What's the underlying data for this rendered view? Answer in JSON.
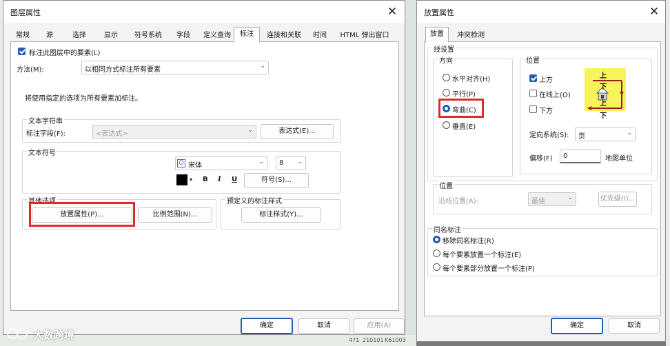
{
  "left_dialog": {
    "title": "图层属性",
    "close": "✕",
    "tabs": [
      "常规",
      "源",
      "选择",
      "显示",
      "符号系统",
      "字段",
      "定义查询",
      "标注",
      "连接和关联",
      "时间",
      "HTML 弹出窗口"
    ],
    "label_features_checkbox": "标注此图层中的要素(L)",
    "method_label": "方法(M):",
    "method_value": "以相同方式标注所有要素",
    "info_text": "将使用指定的选项为所有要素加标注。",
    "text_string_group": "文本字符串",
    "label_field_label": "标注字段(F):",
    "label_field_value": "<表达式>",
    "expression_button": "表达式(E)...",
    "text_symbol_group": "文本符号",
    "font_name": "宋体",
    "font_size": "8",
    "bold": "B",
    "italic": "I",
    "underline": "U",
    "symbol_button": "符号(S)...",
    "other_options_group": "其他选项",
    "placement_button": "放置属性(P)...",
    "scale_range_button": "比例范围(N)...",
    "predefined_group": "预定义的标注样式",
    "label_styles_button": "标注样式(Y)...",
    "ok": "确定",
    "cancel": "取消",
    "apply": "应用(A)"
  },
  "right_dialog": {
    "title": "放置属性",
    "close": "✕",
    "tabs": [
      "放置",
      "冲突检测"
    ],
    "line_settings": "线设置",
    "orientation_group": "方向",
    "orientation_options": [
      "水平对齐(H)",
      "平行(P)",
      "弯曲(C)",
      "垂直(E)"
    ],
    "orientation_selected": "弯曲(C)",
    "position_group": "位置",
    "position_options": [
      {
        "label": "上方",
        "checked": true
      },
      {
        "label": "在线上(O)",
        "checked": false
      },
      {
        "label": "下方",
        "checked": false
      }
    ],
    "preview_above": "上",
    "preview_below": "下",
    "orientation_system_label": "定向系统(S):",
    "orientation_system_value": "页",
    "offset_label": "偏移(F)",
    "offset_value": "0",
    "map_units": "地图单位",
    "location_group": "位置",
    "along_line_label": "沿线位置(A):",
    "along_line_value": "最佳",
    "priority_button": "优先级(I)...",
    "duplicate_group": "同名标注",
    "duplicate_options": [
      "移除同名标注(R)",
      "每个要素放置一个标注(E)",
      "每个要素部分放置一个标注(P)"
    ],
    "duplicate_selected": "移除同名标注(R)",
    "ok": "确定",
    "cancel": "取消"
  },
  "watermark": "大数跨境",
  "background_map_numbers": [
    "471",
    "210101",
    "K61003"
  ],
  "colors": {
    "accent": "#1f5fb3",
    "highlight": "#e02b2b",
    "preview_bg": "#f7f35a",
    "preview_arrow": "#a11d1d"
  }
}
